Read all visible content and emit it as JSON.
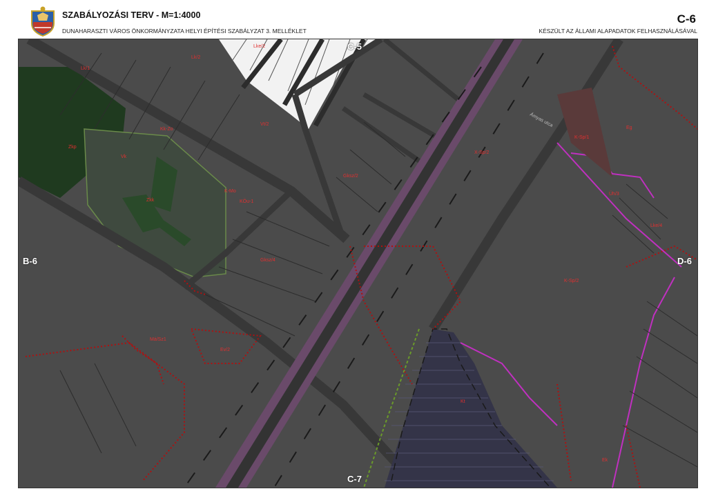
{
  "header": {
    "title": "SZABÁLYOZÁSI TERV   -   M=1:4000",
    "subtitle": "DUNAHARASZTI VÁROS ÖNKORMÁNYZATA HELYI ÉPÍTÉSI SZABÁLYZAT 3. MELLÉKLET",
    "sheet_id": "C-6",
    "basemap_note": "KÉSZÜLT AZ ÁLLAMI ALAPADATOK FELHASZNÁLÁSÁVAL"
  },
  "neighbours": {
    "north": "C-5",
    "south": "C-7",
    "west": "B-6",
    "east": "D-6"
  },
  "colors": {
    "base": "#4b4b4b",
    "park": "#1f3a1f",
    "road": "#3a3a3a",
    "railway": "#7a4a7a",
    "zone_boundary": "#b01010",
    "regulation_line": "#c030c0",
    "ecological": "#6a9a2a"
  },
  "zone_labels": [
    "Lke/2",
    "Lk/1",
    "Lk/2",
    "Vt/2",
    "Zkp",
    "Vk",
    "Kk-Zo",
    "K-Mo",
    "KÖu-1",
    "Gksz/2",
    "Gksz/4",
    "K-Sp/1",
    "K-Sp/2",
    "Üh/3",
    "Lke/4",
    "Eg",
    "Má/Sz1",
    "Ev/2",
    "Kt",
    "Ek",
    "X-Sp/2",
    "Zkk"
  ],
  "street_name": "Ámyas utca"
}
